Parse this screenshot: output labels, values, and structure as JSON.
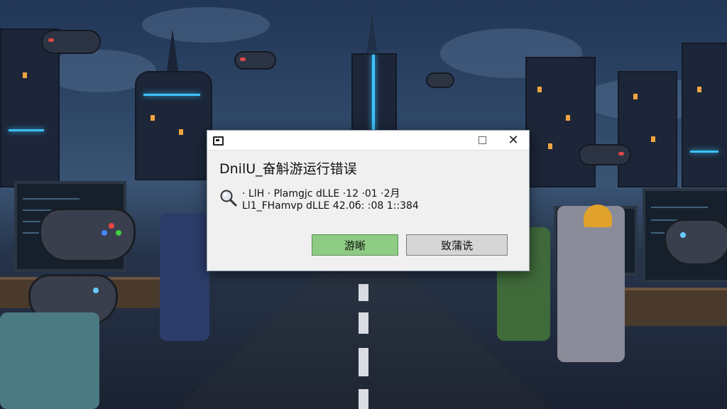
{
  "dialog": {
    "title": "DnilU_奋斛游运行错误",
    "details": [
      "· LlH · Plamgjc dLLE ·12 ·01 ·2月",
      "Ll1_FHamvp dLLE 42.0б: :08 1::384"
    ],
    "buttons": {
      "primary": "游晰",
      "secondary": "致蒲诜"
    },
    "icons": {
      "app": "window-app-icon",
      "details": "magnifier-icon",
      "maximize": "maximize-icon",
      "close": "close-icon"
    },
    "colors": {
      "primary_button": "#8ecb83",
      "secondary_button": "#d6d6d6"
    }
  }
}
